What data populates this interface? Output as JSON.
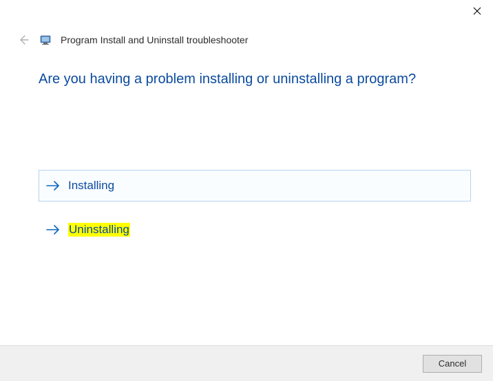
{
  "window": {
    "title": "Program Install and Uninstall troubleshooter"
  },
  "main": {
    "heading": "Are you having a problem installing or uninstalling a program?",
    "options": [
      {
        "label": "Installing"
      },
      {
        "label": "Uninstalling"
      }
    ]
  },
  "footer": {
    "cancel": "Cancel"
  }
}
